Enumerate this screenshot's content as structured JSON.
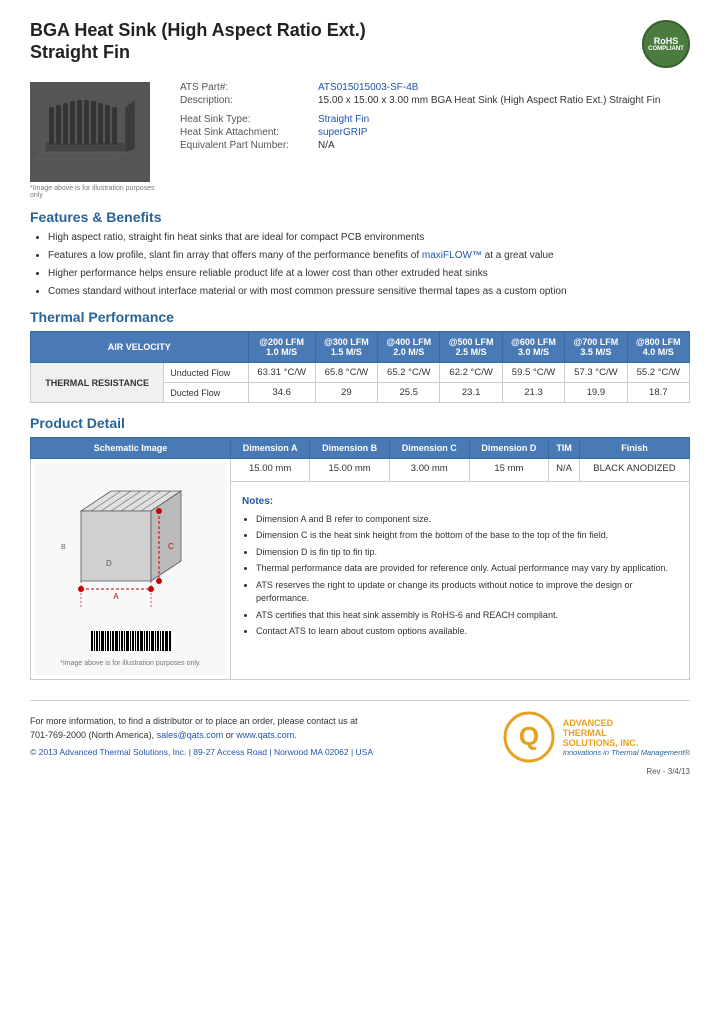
{
  "header": {
    "title_line1": "BGA Heat Sink (High Aspect Ratio Ext.)",
    "title_line2": "Straight Fin",
    "rohs": "RoHS\nCOMPLIANT"
  },
  "product": {
    "part_label": "ATS Part#:",
    "part_number": "ATS015015003-SF-4B",
    "description_label": "Description:",
    "description": "15.00 x 15.00 x 3.00 mm  BGA Heat Sink (High Aspect Ratio Ext.) Straight Fin",
    "heat_sink_type_label": "Heat Sink Type:",
    "heat_sink_type": "Straight Fin",
    "attachment_label": "Heat Sink Attachment:",
    "attachment": "superGRIP",
    "equiv_part_label": "Equivalent Part Number:",
    "equiv_part": "N/A",
    "image_caption": "*Image above is for illustration purposes only"
  },
  "features": {
    "section_title": "Features & Benefits",
    "items": [
      "High aspect ratio, straight fin heat sinks that are ideal for compact PCB environments",
      "Features a low profile, slant fin array that offers many of the performance benefits of maxiFLOW™ at a great value",
      "Higher performance helps ensure reliable product life at a lower cost than other extruded heat sinks",
      "Comes standard without interface material or with most common pressure sensitive thermal tapes as a custom option"
    ]
  },
  "thermal": {
    "section_title": "Thermal Performance",
    "col_header_label": "AIR VELOCITY",
    "columns": [
      {
        "lfm": "@200 LFM",
        "ms": "1.0 M/S"
      },
      {
        "lfm": "@300 LFM",
        "ms": "1.5 M/S"
      },
      {
        "lfm": "@400 LFM",
        "ms": "2.0 M/S"
      },
      {
        "lfm": "@500 LFM",
        "ms": "2.5 M/S"
      },
      {
        "lfm": "@600 LFM",
        "ms": "3.0 M/S"
      },
      {
        "lfm": "@700 LFM",
        "ms": "3.5 M/S"
      },
      {
        "lfm": "@800 LFM",
        "ms": "4.0 M/S"
      }
    ],
    "row_label": "THERMAL RESISTANCE",
    "rows": [
      {
        "type": "Unducted Flow",
        "values": [
          "63.31 °C/W",
          "65.8 °C/W",
          "65.2 °C/W",
          "62.2 °C/W",
          "59.5 °C/W",
          "57.3 °C/W",
          "55.2 °C/W"
        ]
      },
      {
        "type": "Ducted Flow",
        "values": [
          "34.6",
          "29",
          "25.5",
          "23.1",
          "21.3",
          "19.9",
          "18.7"
        ]
      }
    ]
  },
  "product_detail": {
    "section_title": "Product Detail",
    "table_headers": [
      "Schematic Image",
      "Dimension A",
      "Dimension B",
      "Dimension C",
      "Dimension D",
      "TIM",
      "Finish"
    ],
    "dimensions": {
      "a": "15.00 mm",
      "b": "15.00 mm",
      "c": "3.00 mm",
      "d": "15 mm",
      "tim": "N/A",
      "finish": "BLACK ANODIZED"
    },
    "notes_title": "Notes:",
    "notes": [
      "Dimension A and B refer to component size.",
      "Dimension C is the heat sink height from the bottom of the base to the top of the fin field.",
      "Dimension D is fin tip to fin tip.",
      "Thermal performance data are provided for reference only. Actual performance may vary by application.",
      "ATS reserves the right to update or change its products without notice to improve the design or performance.",
      "ATS certifies that this heat sink assembly is RoHS-6 and REACH compliant.",
      "Contact ATS to learn about custom options available."
    ],
    "schematic_caption": "*Image above is for illustration purposes only."
  },
  "footer": {
    "contact_text": "For more information, to find a distributor or to place an order, please contact us at\n701-769-2000 (North America),",
    "email": "sales@qats.com",
    "or_text": "or",
    "website": "www.qats.com.",
    "copyright": "© 2013 Advanced Thermal Solutions, Inc.  |  89-27 Access Road  |  Norwood MA  02062  |  USA",
    "ats_name1": "ADVANCED",
    "ats_name2": "THERMAL",
    "ats_name3": "SOLUTIONS, INC.",
    "ats_tagline": "Innovations in Thermal Management®",
    "page_number": "Rev - 3/4/13"
  }
}
